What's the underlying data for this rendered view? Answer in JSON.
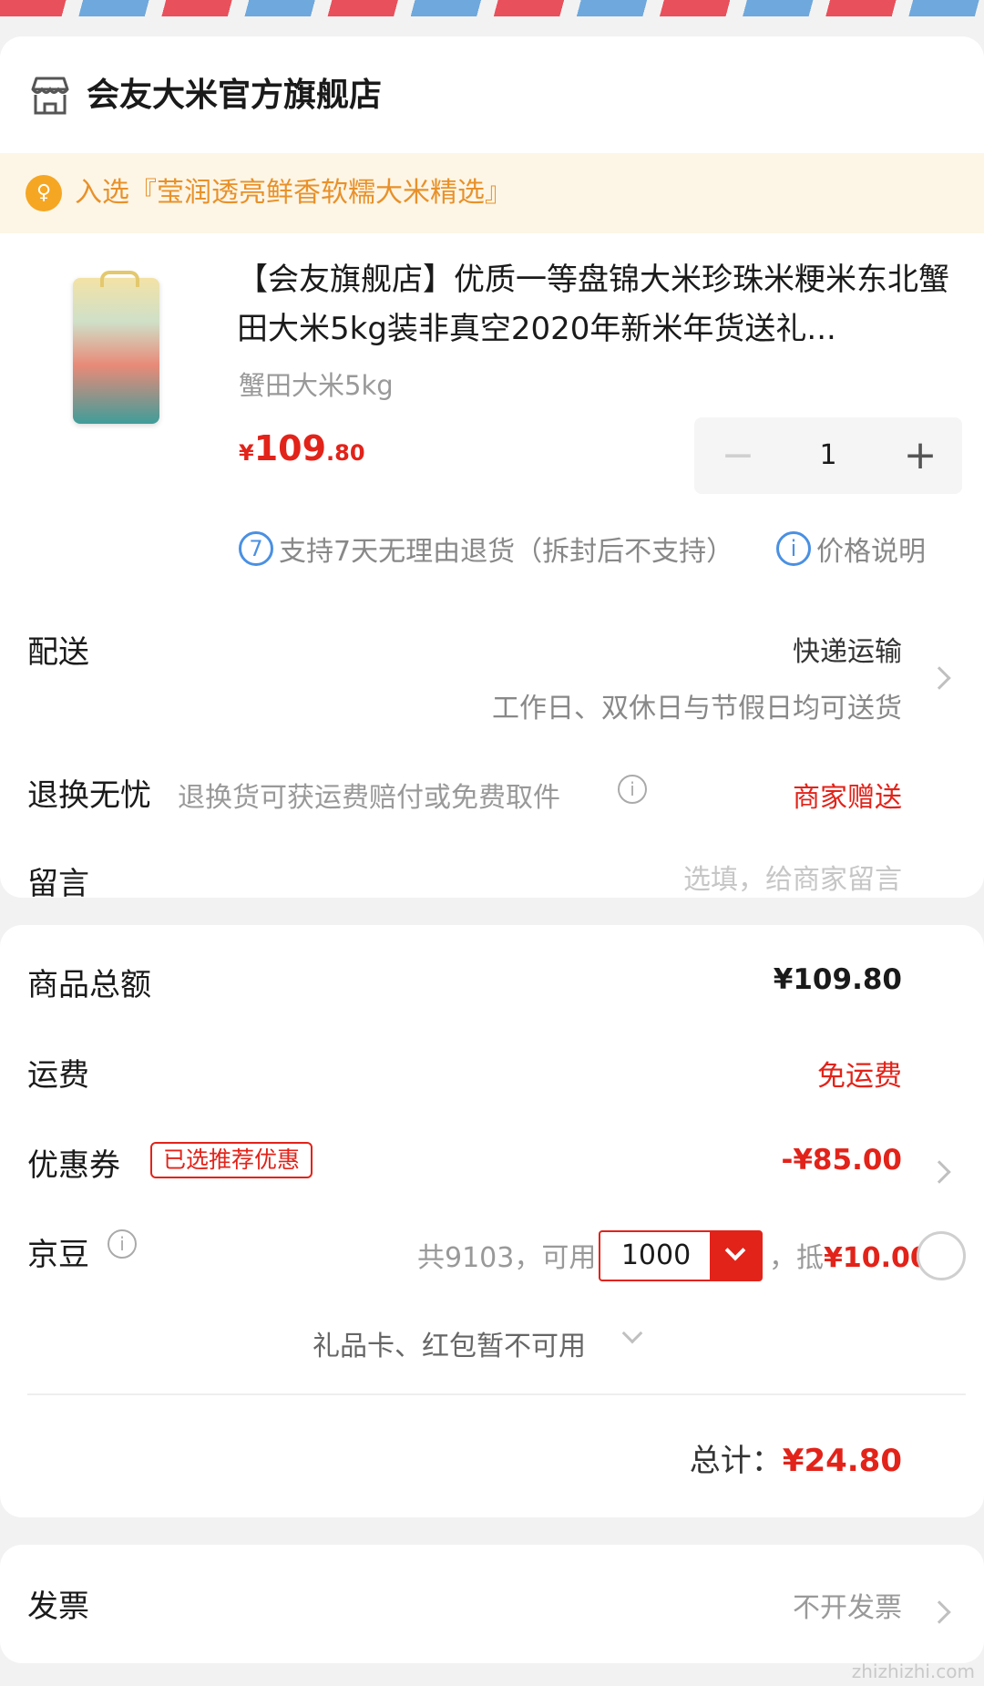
{
  "store": {
    "name": "会友大米官方旗舰店",
    "icon": "store-icon"
  },
  "promo": {
    "text": "入选『莹润透亮鲜香软糯大米精选』",
    "icon": "trophy-icon"
  },
  "product": {
    "title": "【会友旗舰店】优质一等盘锦大米珍珠米粳米东北蟹田大米5kg装非真空2020年新米年货送礼...",
    "spec": "蟹田大米5kg",
    "price_currency": "¥",
    "price_int": "109",
    "price_dec": ".80",
    "quantity": "1",
    "return_icon_text": "7",
    "return_policy": "支持7天无理由退货（拆封后不支持）",
    "price_note_icon_text": "i",
    "price_note": "价格说明"
  },
  "shipping": {
    "label": "配送",
    "method": "快递运输",
    "note": "工作日、双休日与节假日均可送货"
  },
  "returns": {
    "label": "退换无忧",
    "desc": "退换货可获运费赔付或免费取件",
    "value": "商家赠送"
  },
  "message": {
    "label": "留言",
    "placeholder": "选填，给商家留言"
  },
  "summary": {
    "goods_label": "商品总额",
    "goods_value": "¥109.80",
    "freight_label": "运费",
    "freight_value": "免运费",
    "coupon_label": "优惠券",
    "coupon_badge": "已选推荐优惠",
    "coupon_value": "-¥85.00",
    "beans_label": "京豆",
    "beans_total": "共9103，可用",
    "beans_selected": "1000",
    "beans_deduct_prefix": "，抵",
    "beans_deduct_value": "¥10.00",
    "gift_note": "礼品卡、红包暂不可用",
    "total_label": "总计：",
    "total_value": "¥24.80"
  },
  "invoice": {
    "label": "发票",
    "value": "不开发票"
  },
  "watermark": "zhizhizhi.com",
  "colors": {
    "accent": "#e2231a",
    "promo": "#e8912a",
    "link": "#4a90e2"
  }
}
